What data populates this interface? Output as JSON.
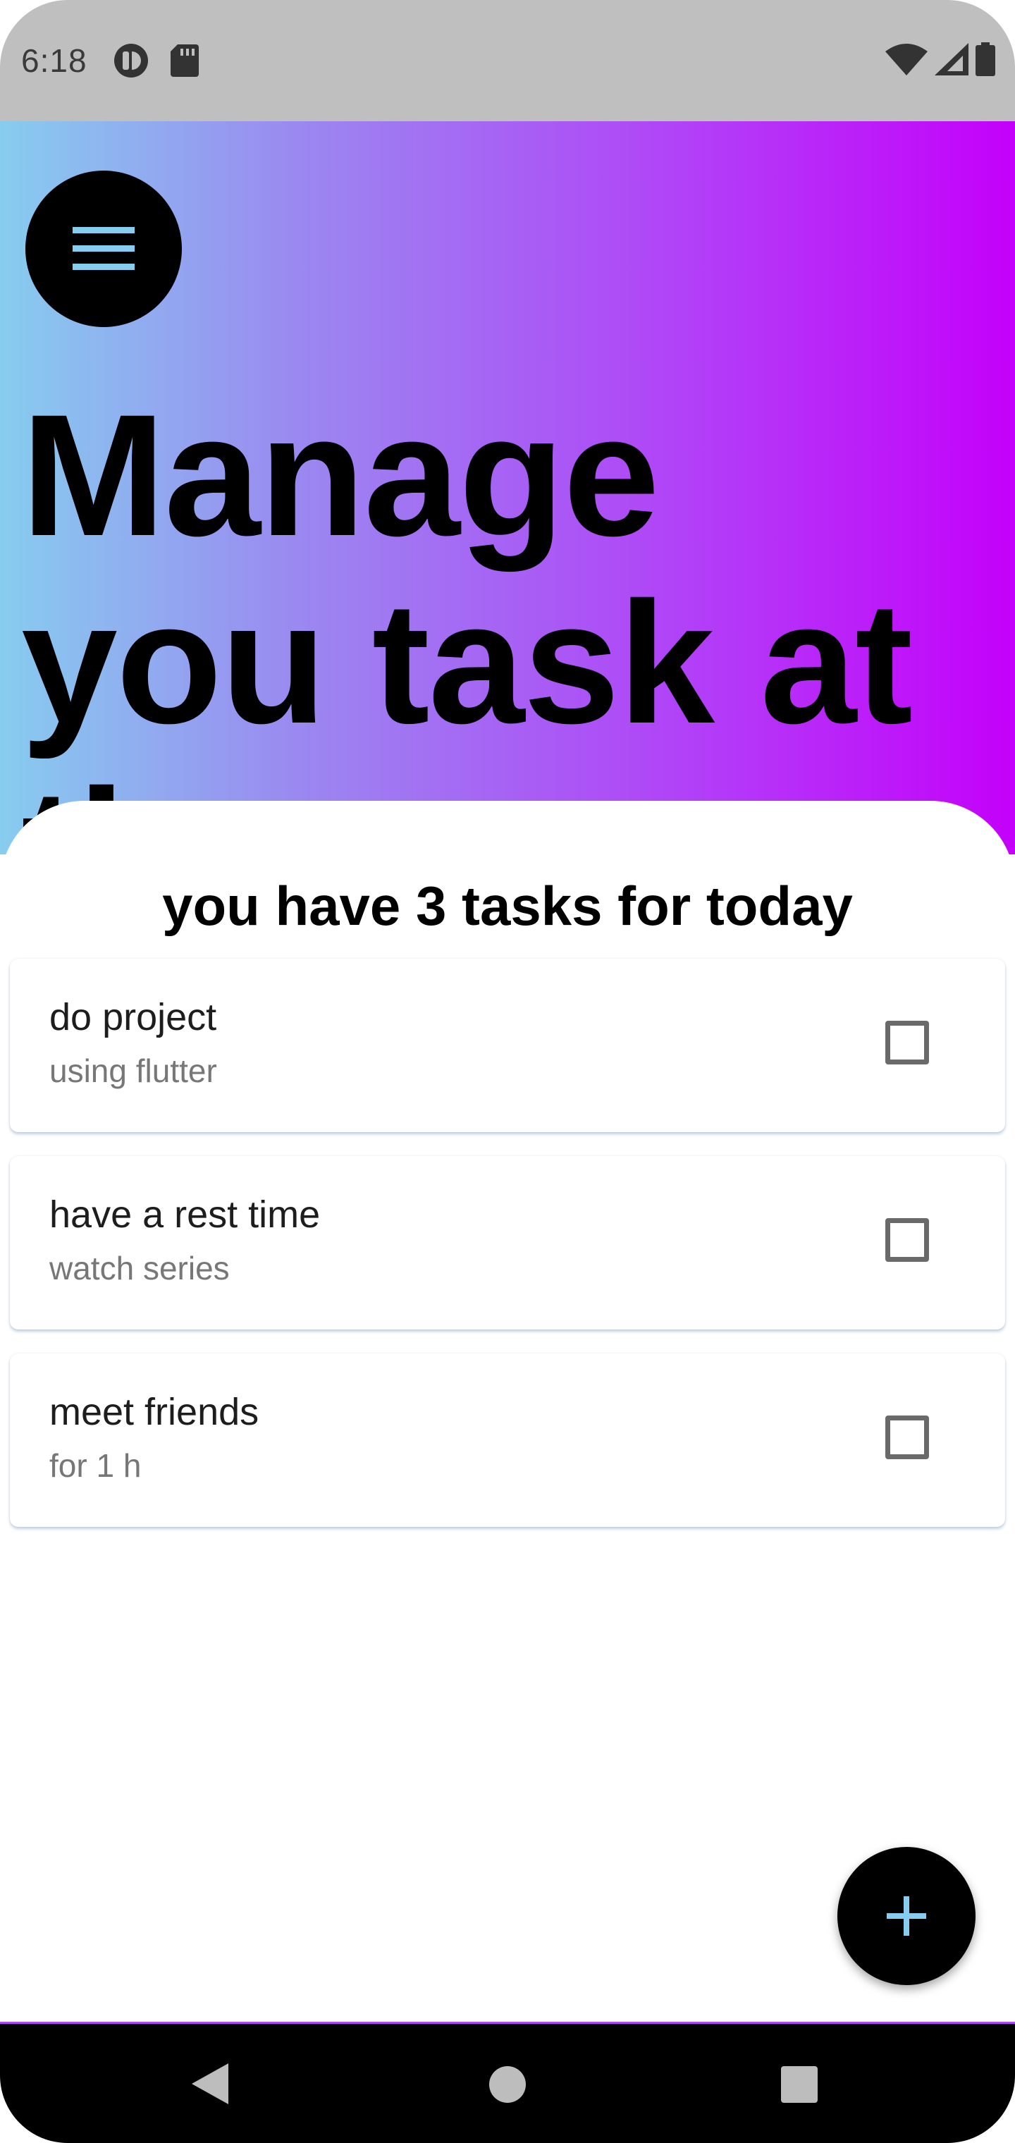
{
  "status_bar": {
    "time": "6:18",
    "left_icons": [
      "privacy-dot-icon",
      "sd-card-icon"
    ],
    "right_icons": [
      "wifi-icon",
      "signal-icon",
      "battery-icon"
    ]
  },
  "header": {
    "menu_icon": "hamburger-menu-icon",
    "headline": "Manage you task at time",
    "gradient": [
      "#87cdef",
      "#c400fa"
    ]
  },
  "main": {
    "task_count_text": "you have 3 tasks for today",
    "tasks": [
      {
        "title": "do project",
        "subtitle": "using flutter",
        "checked": false
      },
      {
        "title": "have a rest time",
        "subtitle": "watch series",
        "checked": false
      },
      {
        "title": "meet friends",
        "subtitle": "for 1 h",
        "checked": false
      }
    ]
  },
  "fab": {
    "icon": "plus-icon",
    "icon_color": "#87cdef"
  },
  "nav_bar": {
    "buttons": [
      "back-icon",
      "home-icon",
      "recents-icon"
    ]
  },
  "colors": {
    "accent": "#87cdef",
    "purple": "#c400fa",
    "dark": "#000000"
  }
}
